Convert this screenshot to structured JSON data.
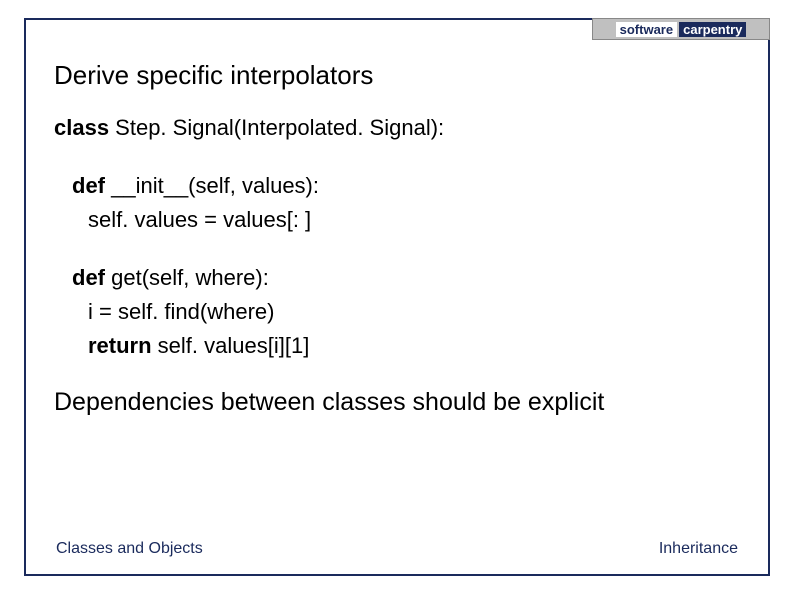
{
  "logo": {
    "left": "software",
    "right": "carpentry"
  },
  "title": "Derive specific interpolators",
  "code": {
    "kw_class": "class",
    "class_sig": " Step. Signal(Interpolated. Signal):",
    "kw_def1": "def",
    "init_sig": " __init__(self, values):",
    "init_body": "self. values = values[: ]",
    "kw_def2": "def",
    "get_sig": " get(self, where):",
    "get_body1": "i = self. find(where)",
    "kw_return": "return",
    "get_body2": " self. values[i][1]"
  },
  "note": "Dependencies between classes should be explicit",
  "footer": {
    "left": "Classes and Objects",
    "right": "Inheritance"
  }
}
